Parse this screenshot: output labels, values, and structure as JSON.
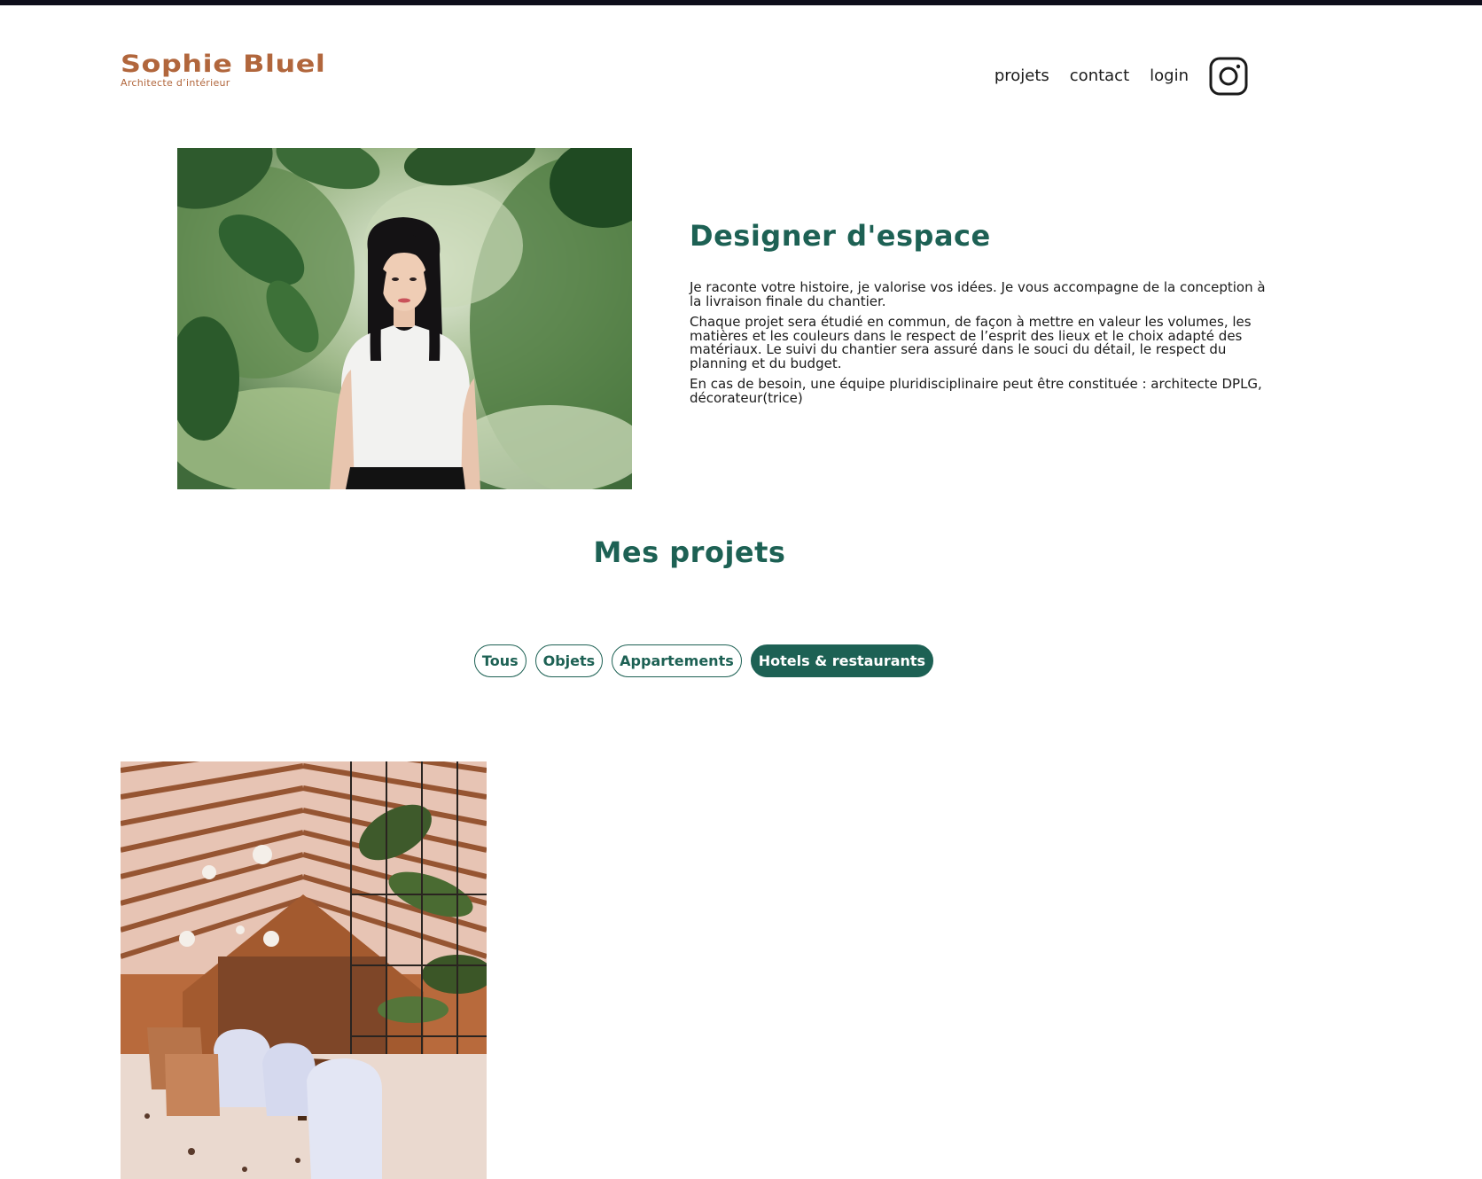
{
  "header": {
    "brand_name": "Sophie Bluel",
    "brand_tagline": "Architecte d’intérieur",
    "nav": [
      {
        "label": "projets"
      },
      {
        "label": "contact"
      },
      {
        "label": "login"
      }
    ],
    "social_icon": "instagram-icon"
  },
  "intro": {
    "title": "Designer d'espace",
    "paragraphs": [
      "Je raconte votre histoire, je valorise vos idées. Je vous accompagne de la conception à la livraison finale du chantier.",
      "Chaque projet sera étudié en commun, de façon à mettre en valeur les volumes, les matières et les couleurs dans le respect de l’esprit des lieux et le choix adapté des matériaux. Le suivi du chantier sera assuré dans le souci du détail, le respect du planning et du budget.",
      "En cas de besoin, une équipe pluridisciplinaire peut être constituée : architecte DPLG, décorateur(trice)"
    ]
  },
  "projects": {
    "title": "Mes projets",
    "filters": [
      {
        "label": "Tous",
        "active": false
      },
      {
        "label": "Objets",
        "active": false
      },
      {
        "label": "Appartements",
        "active": false
      },
      {
        "label": "Hotels & restaurants",
        "active": true
      }
    ]
  },
  "colors": {
    "brand": "#b1663c",
    "accent": "#1d6154",
    "topbar": "#0e0e1a"
  }
}
